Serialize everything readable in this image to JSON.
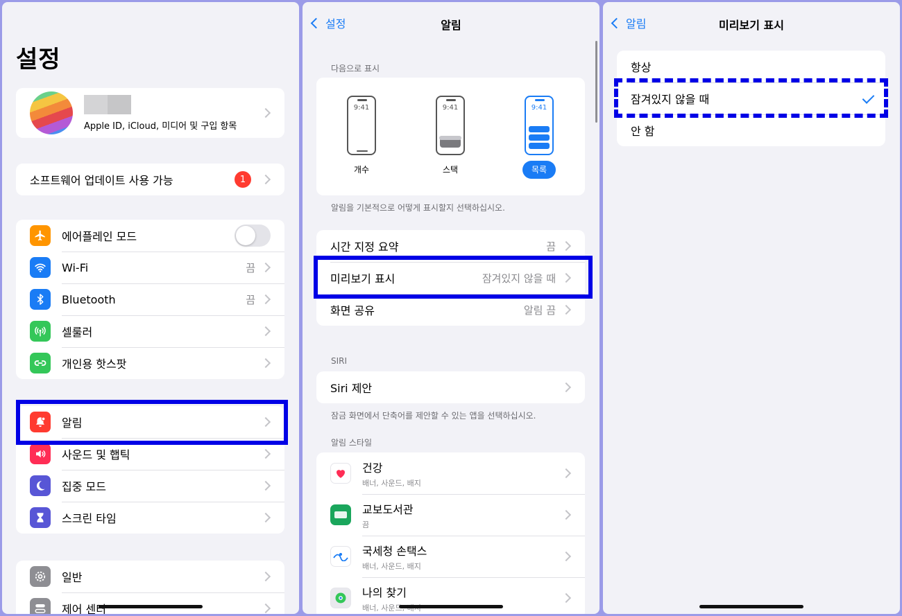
{
  "settings": {
    "title": "설정",
    "profile_subtitle": "Apple ID, iCloud, 미디어 및 구입 항목",
    "update_label": "소프트웨어 업데이트 사용 가능",
    "update_badge": "1",
    "connectivity": [
      {
        "label": "에어플레인 모드",
        "value": "",
        "color": "#ff9500",
        "icon": "airplane-icon"
      },
      {
        "label": "Wi-Fi",
        "value": "끔",
        "color": "#1a7cf5",
        "icon": "wifi-icon"
      },
      {
        "label": "Bluetooth",
        "value": "끔",
        "color": "#1a7cf5",
        "icon": "bluetooth-icon"
      },
      {
        "label": "셀룰러",
        "value": "",
        "color": "#34c759",
        "icon": "cellular-icon"
      },
      {
        "label": "개인용 핫스팟",
        "value": "",
        "color": "#34c759",
        "icon": "hotspot-icon"
      }
    ],
    "notifications_group": [
      {
        "label": "알림",
        "color": "#ff3b30",
        "icon": "bell-icon"
      },
      {
        "label": "사운드 및 햅틱",
        "color": "#ff2d55",
        "icon": "speaker-icon"
      },
      {
        "label": "집중 모드",
        "color": "#5856d6",
        "icon": "moon-icon"
      },
      {
        "label": "스크린 타임",
        "color": "#5856d6",
        "icon": "hourglass-icon"
      }
    ],
    "general_group": [
      {
        "label": "일반",
        "color": "#8e8e93",
        "icon": "gear-icon"
      },
      {
        "label": "제어 센터",
        "color": "#8e8e93",
        "icon": "switches-icon"
      }
    ]
  },
  "notifications": {
    "back": "설정",
    "title": "알림",
    "display_header": "다음으로 표시",
    "styles": [
      {
        "time": "9:41",
        "label": "개수",
        "selected": false
      },
      {
        "time": "9:41",
        "label": "스택",
        "selected": false
      },
      {
        "time": "9:41",
        "label": "목록",
        "selected": true
      }
    ],
    "display_footer": "알림을 기본적으로 어떻게 표시할지 선택하십시오.",
    "rows": [
      {
        "label": "시간 지정 요약",
        "value": "끔"
      },
      {
        "label": "미리보기 표시",
        "value": "잠겨있지 않을 때"
      },
      {
        "label": "화면 공유",
        "value": "알림 끔"
      }
    ],
    "siri_header": "SIRI",
    "siri_label": "Siri 제안",
    "siri_footer": "잠금 화면에서 단축어를 제안할 수 있는 앱을 선택하십시오.",
    "apps_header": "알림 스타일",
    "apps": [
      {
        "name": "건강",
        "sub": "배너, 사운드, 배지",
        "icon": "health-icon"
      },
      {
        "name": "교보도서관",
        "sub": "끔",
        "icon": "kyobo-library-icon"
      },
      {
        "name": "국세청 손택스",
        "sub": "배너, 사운드, 배지",
        "icon": "hometax-icon"
      },
      {
        "name": "나의 찾기",
        "sub": "배너, 사운드, 배지",
        "icon": "find-my-icon"
      }
    ]
  },
  "preview": {
    "back": "알림",
    "title": "미리보기 표시",
    "options": [
      {
        "label": "항상",
        "checked": false
      },
      {
        "label": "잠겨있지 않을 때",
        "checked": true
      },
      {
        "label": "안 함",
        "checked": false
      }
    ]
  },
  "colors": {
    "accent": "#1a7cf5",
    "highlight": "#0000e6",
    "badge": "#ff3b30"
  }
}
